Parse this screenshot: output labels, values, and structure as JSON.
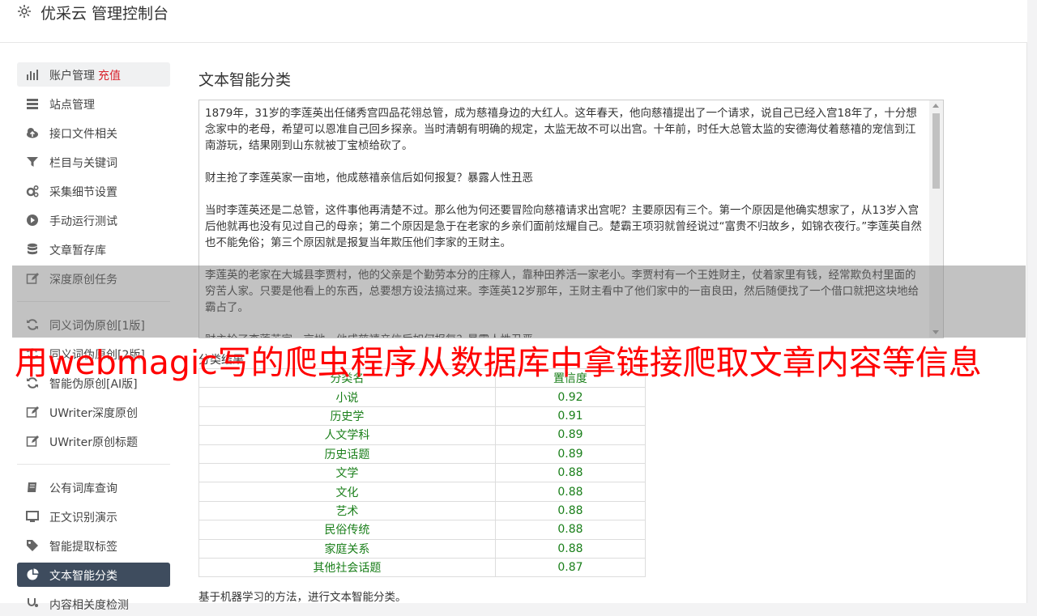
{
  "header": {
    "title": "优采云 管理控制台"
  },
  "sidebar": {
    "items": [
      {
        "label": "账户管理",
        "extra": "充值",
        "icon": "bar-chart-icon"
      },
      {
        "label": "站点管理",
        "icon": "server-icon"
      },
      {
        "label": "接口文件相关",
        "icon": "cloud-upload-icon"
      },
      {
        "label": "栏目与关键词",
        "icon": "filter-icon"
      },
      {
        "label": "采集细节设置",
        "icon": "cogs-icon"
      },
      {
        "label": "手动运行测试",
        "icon": "play-icon"
      },
      {
        "label": "文章暂存库",
        "icon": "database-icon"
      },
      {
        "label": "深度原创任务",
        "icon": "edit-icon"
      },
      {
        "label": "同义词伪原创[1版]",
        "icon": "refresh-icon"
      },
      {
        "label": "同义词伪原创[2版]",
        "icon": "refresh-icon"
      },
      {
        "label": "智能伪原创[AI版]",
        "icon": "refresh-icon"
      },
      {
        "label": "UWriter深度原创",
        "icon": "edit-icon"
      },
      {
        "label": "UWriter原创标题",
        "icon": "edit-icon"
      },
      {
        "label": "公有词库查询",
        "icon": "book-icon"
      },
      {
        "label": "正文识别演示",
        "icon": "monitor-icon"
      },
      {
        "label": "智能提取标签",
        "icon": "tag-icon"
      },
      {
        "label": "文本智能分类",
        "icon": "pie-chart-icon"
      },
      {
        "label": "内容相关度检测",
        "icon": "stethoscope-icon"
      }
    ]
  },
  "main": {
    "title": "文本智能分类",
    "text_paragraphs": [
      "1879年，31岁的李莲英出任储秀宫四品花翎总管，成为慈禧身边的大红人。这年春天，他向慈禧提出了一个请求，说自己已经入宫18年了，十分想念家中的老母，希望可以恩准自己回乡探亲。当时清朝有明确的规定，太监无故不可以出宫。十年前，时任大总管太监的安德海仗着慈禧的宠信到江南游玩，结果刚到山东就被丁宝桢给砍了。",
      "财主抢了李莲英家一亩地，他成慈禧亲信后如何报复？暴露人性丑恶",
      "当时李莲英还是二总管，这件事他再清楚不过。那么他为何还要冒险向慈禧请求出宫呢？主要原因有三个。第一个原因是他确实想家了，从13岁入宫后他就再也没有见过自己的母亲；第二个原因是急于在老家的乡亲们面前炫耀自己。楚霸王项羽就曾经说过“富贵不归故乡，如锦衣夜行。”李莲英自然也不能免俗；第三个原因就是报复当年欺压他们李家的王财主。",
      "李莲英的老家在大城县李贾村，他的父亲是个勤劳本分的庄稼人，靠种田养活一家老小。李贾村有一个王姓财主，仗着家里有钱，经常欺负村里面的穷苦人家。只要是他看上的东西，总要想方设法搞过来。李莲英12岁那年，王财主看中了他们家中的一亩良田，然后随便找了一个借口就把这块地给霸占了。",
      "财主抢了李莲英家一亩地，他成慈禧亲信后如何报复？暴露人性丑恶"
    ],
    "result_title": "分类结果",
    "table_headers": [
      "分类名",
      "置信度"
    ],
    "table_rows": [
      [
        "小说",
        "0.92"
      ],
      [
        "历史学",
        "0.91"
      ],
      [
        "人文学科",
        "0.89"
      ],
      [
        "历史话题",
        "0.89"
      ],
      [
        "文学",
        "0.88"
      ],
      [
        "文化",
        "0.88"
      ],
      [
        "艺术",
        "0.88"
      ],
      [
        "民俗传统",
        "0.88"
      ],
      [
        "家庭关系",
        "0.88"
      ],
      [
        "其他社会话题",
        "0.87"
      ]
    ],
    "description": "基于机器学习的方法，进行文本智能分类。"
  },
  "watermark": "用webmagic写的爬虫程序从数据库中拿链接爬取文章内容等信息",
  "colors": {
    "active_nav": "#3e4c5e",
    "recharge": "#d9232d",
    "table_text": "#1a7f1a",
    "watermark": "#ff0000"
  }
}
